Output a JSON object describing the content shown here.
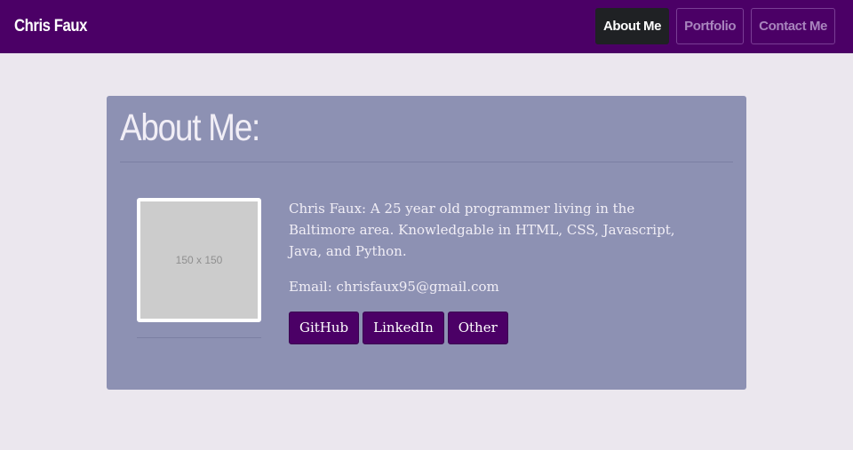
{
  "navbar": {
    "brand": "Chris Faux",
    "links": [
      {
        "label": "About Me",
        "active": true
      },
      {
        "label": "Portfolio",
        "active": false
      },
      {
        "label": "Contact Me",
        "active": false
      }
    ]
  },
  "about": {
    "title": "About Me:",
    "image_placeholder": "150 x 150",
    "bio": "Chris Faux: A 25 year old programmer living in the Baltimore area. Knowledgable in HTML, CSS, Javascript, Java, and Python.",
    "email": "Email: chrisfaux95@gmail.com",
    "buttons": [
      {
        "label": "GitHub"
      },
      {
        "label": "LinkedIn"
      },
      {
        "label": "Other"
      }
    ]
  },
  "colors": {
    "navbar_bg": "#4b0066",
    "active_link_bg": "#1f2124",
    "page_bg": "#ebe7ee",
    "card_bg": "#8d91b3",
    "button_bg": "#4b0066"
  }
}
